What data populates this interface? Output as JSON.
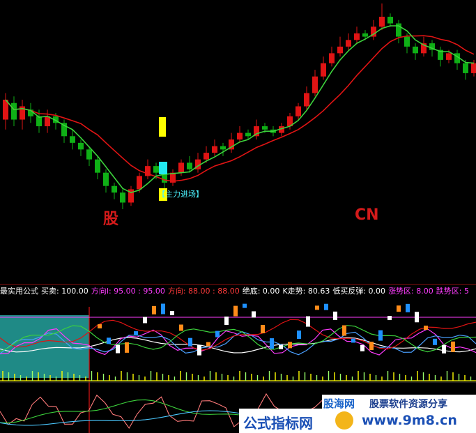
{
  "indicator_bar": {
    "items": [
      {
        "text": "最实用公式",
        "color": "#ffffff"
      },
      {
        "text": "买卖: 100.00",
        "color": "#ffffff"
      },
      {
        "text": "方向I: 95.00 : 95.00",
        "color": "#ff3cff"
      },
      {
        "text": "方向: 88.00 : 88.00",
        "color": "#ff3a3a"
      },
      {
        "text": "绝底: 0.00",
        "color": "#ffffff"
      },
      {
        "text": "K走势: 80.63",
        "color": "#ffffff"
      },
      {
        "text": "低买反弹: 0.00",
        "color": "#ffffff"
      },
      {
        "text": "涨势区: 8.00",
        "color": "#ff3cff"
      },
      {
        "text": "跌势区: 5",
        "color": "#ff3cff"
      }
    ]
  },
  "annotations": {
    "zhuli": "【主力进场】",
    "gu": "股",
    "cn": "CN"
  },
  "watermarks": {
    "site_name": "股海网",
    "site_slogan": "股票软件资源分享",
    "formula_site": "公式指标网",
    "url": "www.9m8.cn"
  },
  "colors": {
    "background": "#000000",
    "up_candle": "#e01414",
    "down_candle": "#0fb016",
    "ma_red": "#e01414",
    "ma_green": "#3cd23c",
    "teal_zone": "#1f8a86"
  },
  "chart_data": {
    "type": "candlestick",
    "series": [
      {
        "name": "price",
        "ohlc": [
          [
            120,
            126,
            117,
            128
          ],
          [
            125,
            120,
            118,
            127
          ],
          [
            120,
            124,
            117,
            126
          ],
          [
            123,
            121,
            119,
            125
          ],
          [
            121,
            118,
            116,
            123
          ],
          [
            118,
            121,
            116,
            123
          ],
          [
            121,
            119,
            117,
            122
          ],
          [
            119,
            115,
            113,
            120
          ],
          [
            115,
            113,
            111,
            117
          ],
          [
            113,
            111,
            109,
            114
          ],
          [
            111,
            108,
            106,
            112
          ],
          [
            108,
            104,
            102,
            109
          ],
          [
            104,
            100,
            98,
            105
          ],
          [
            100,
            98,
            96,
            101
          ],
          [
            98,
            95,
            93,
            99
          ],
          [
            95,
            99,
            94,
            100
          ],
          [
            99,
            103,
            98,
            104
          ],
          [
            103,
            106,
            102,
            108
          ],
          [
            106,
            104,
            102,
            107
          ],
          [
            104,
            101,
            99,
            105
          ],
          [
            101,
            104,
            100,
            105
          ],
          [
            104,
            107,
            103,
            108
          ],
          [
            107,
            105,
            104,
            109
          ],
          [
            105,
            108,
            104,
            110
          ],
          [
            108,
            110,
            107,
            112
          ],
          [
            110,
            112,
            109,
            114
          ],
          [
            112,
            111,
            109,
            113
          ],
          [
            111,
            114,
            110,
            116
          ],
          [
            114,
            116,
            113,
            118
          ],
          [
            116,
            115,
            114,
            117
          ],
          [
            115,
            118,
            114,
            120
          ],
          [
            118,
            117,
            116,
            119
          ],
          [
            117,
            116,
            115,
            118
          ],
          [
            116,
            118,
            115,
            119
          ],
          [
            118,
            121,
            117,
            122
          ],
          [
            121,
            124,
            120,
            125
          ],
          [
            124,
            128,
            123,
            130
          ],
          [
            128,
            133,
            127,
            135
          ],
          [
            133,
            137,
            132,
            139
          ],
          [
            137,
            140,
            136,
            142
          ],
          [
            140,
            142,
            139,
            145
          ],
          [
            142,
            144,
            141,
            146
          ],
          [
            144,
            146,
            143,
            148
          ],
          [
            146,
            145,
            144,
            147
          ],
          [
            145,
            148,
            144,
            150
          ],
          [
            148,
            151,
            147,
            155
          ],
          [
            151,
            149,
            148,
            152
          ],
          [
            149,
            145,
            143,
            150
          ],
          [
            145,
            142,
            140,
            146
          ],
          [
            142,
            140,
            138,
            143
          ],
          [
            140,
            143,
            139,
            145
          ],
          [
            143,
            141,
            139,
            144
          ],
          [
            141,
            138,
            136,
            142
          ],
          [
            138,
            140,
            137,
            141
          ],
          [
            140,
            137,
            135,
            141
          ],
          [
            137,
            134,
            132,
            138
          ],
          [
            134,
            137,
            133,
            138
          ]
        ]
      }
    ],
    "ma_series": [
      "MA red",
      "MA green"
    ],
    "subpanel_series": [
      "方向I",
      "方向",
      "K走势",
      "低买反弹",
      "涨势区",
      "跌势区"
    ]
  }
}
